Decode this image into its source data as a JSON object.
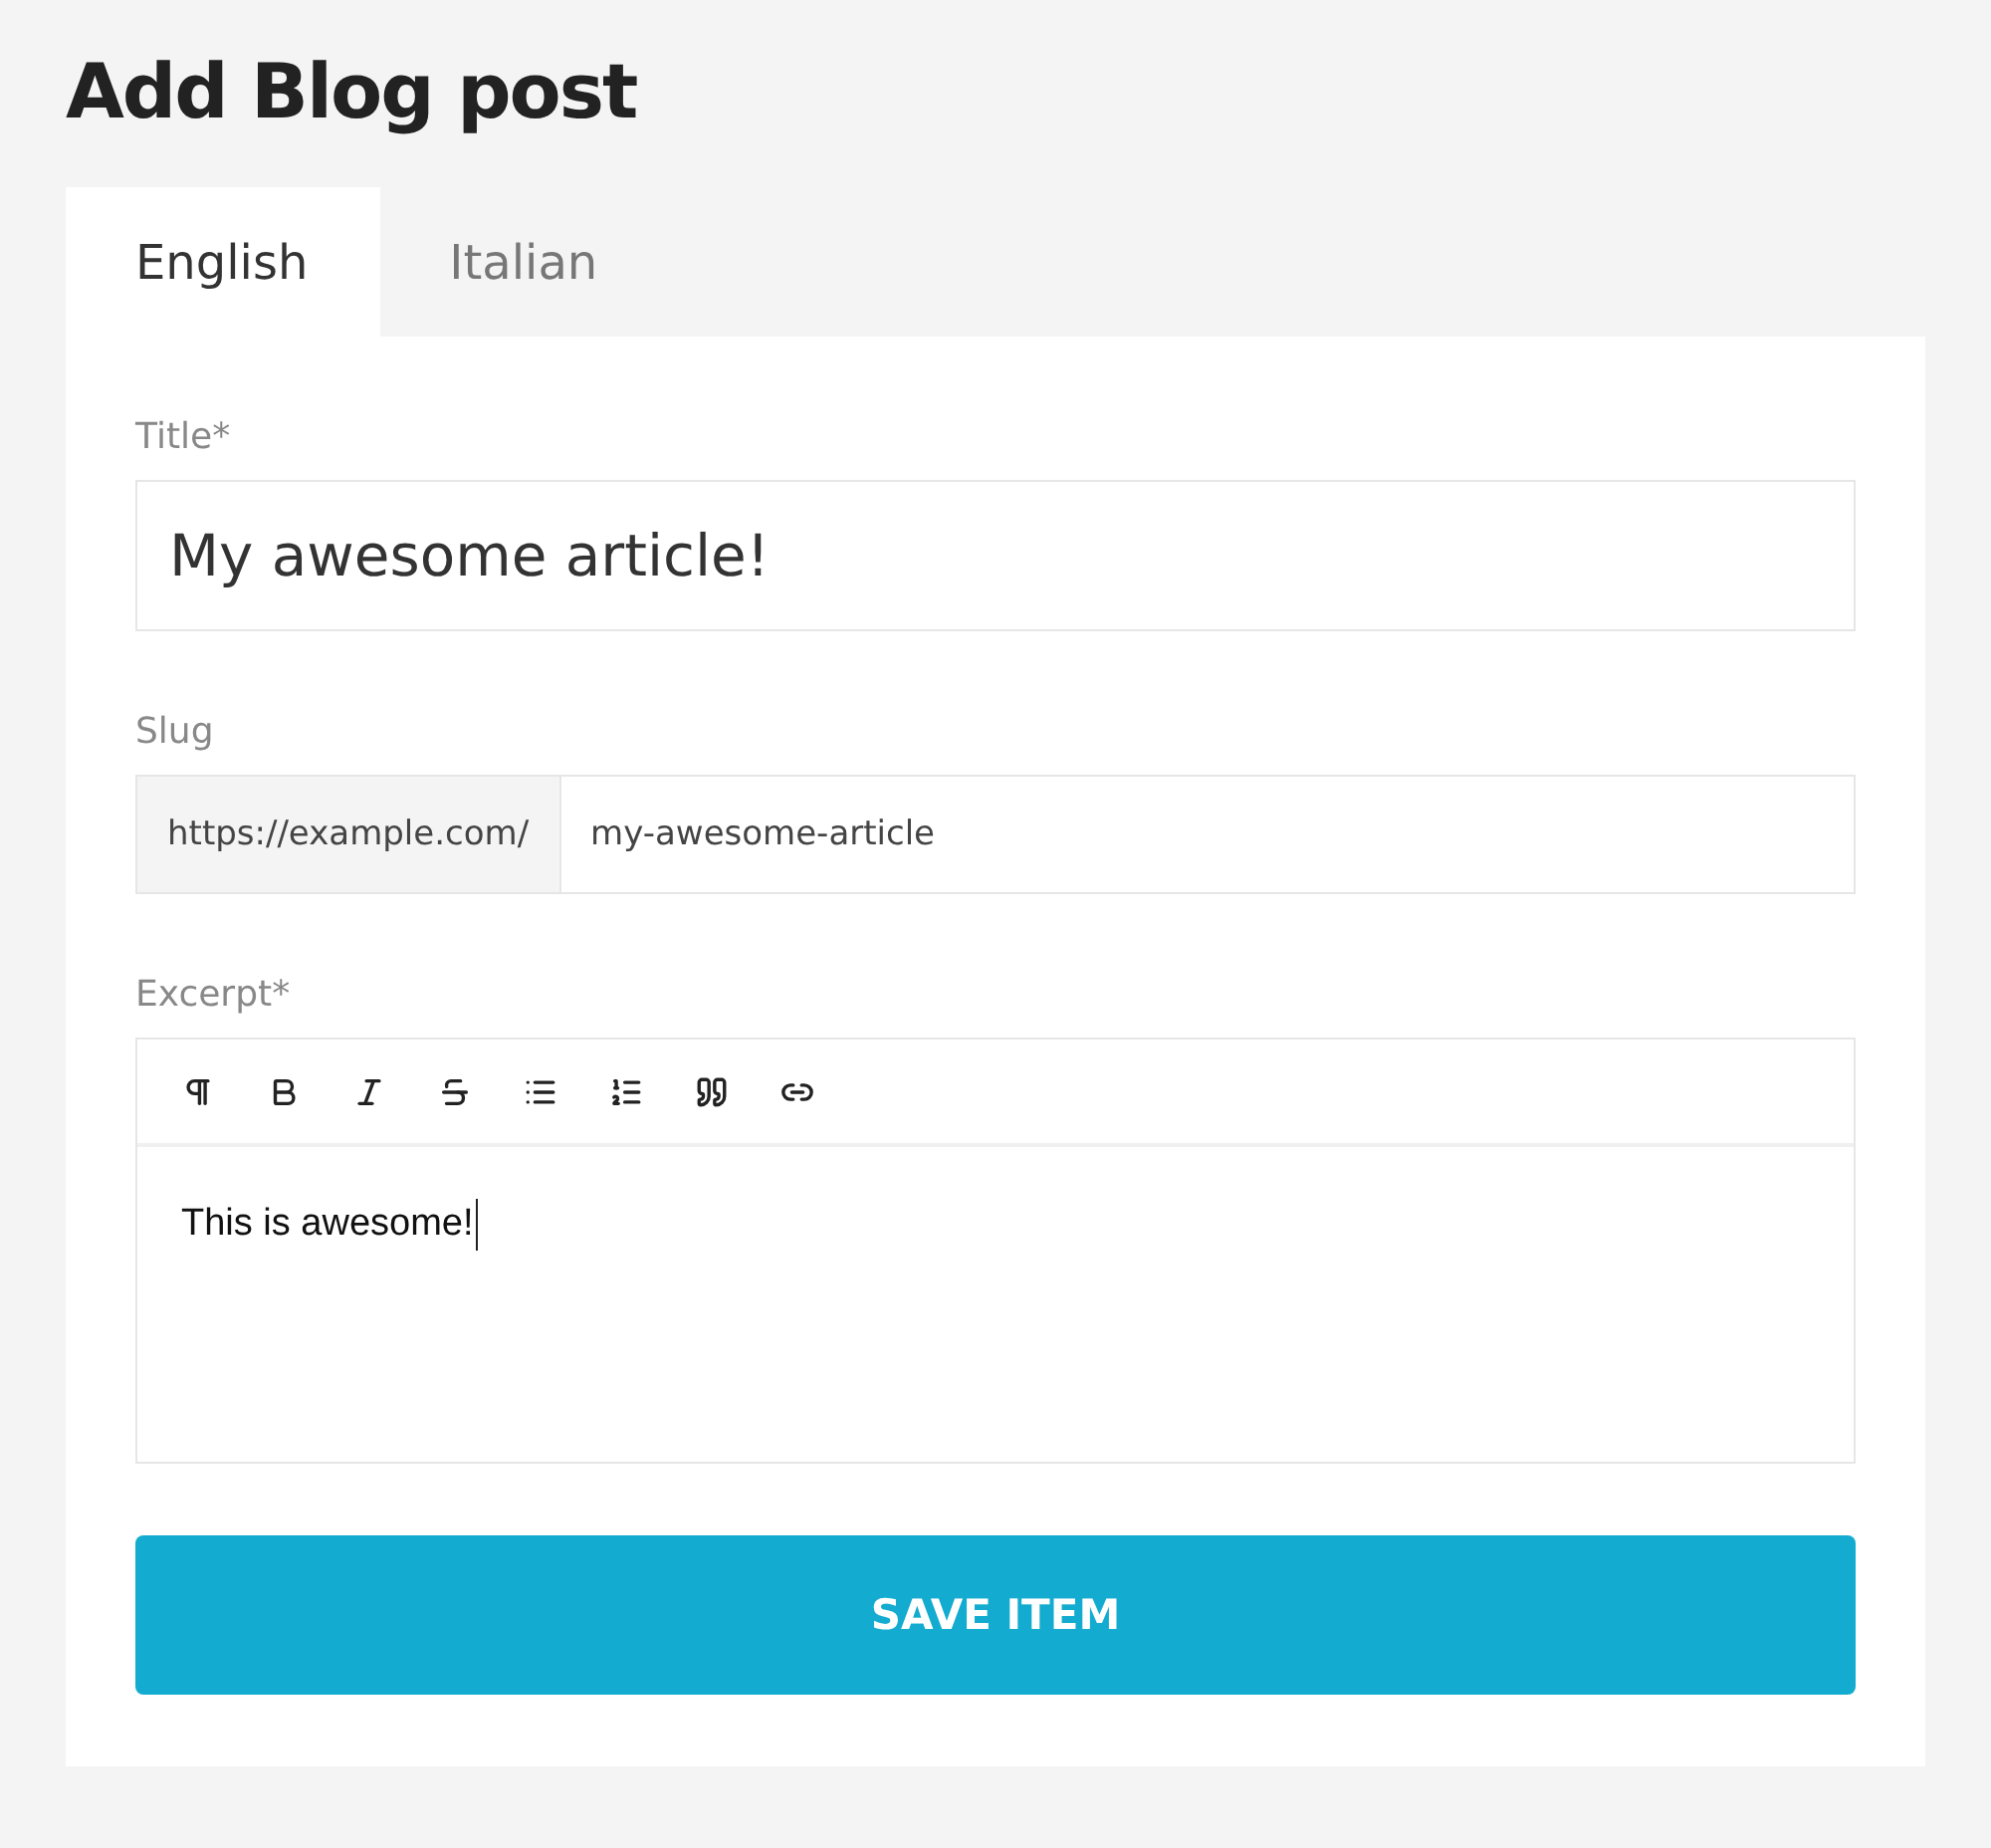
{
  "page_title": "Add Blog post",
  "tabs": [
    {
      "label": "English",
      "selected": true
    },
    {
      "label": "Italian",
      "selected": false
    }
  ],
  "form": {
    "title": {
      "label": "Title*",
      "value": "My awesome article!"
    },
    "slug": {
      "label": "Slug",
      "prefix": "https://example.com/",
      "value": "my-awesome-article"
    },
    "excerpt": {
      "label": "Excerpt*",
      "toolbar": [
        {
          "kind": "paragraph"
        },
        {
          "kind": "bold"
        },
        {
          "kind": "italic"
        },
        {
          "kind": "strike"
        },
        {
          "kind": "bullets"
        },
        {
          "kind": "numbers"
        },
        {
          "kind": "quote"
        },
        {
          "kind": "link"
        }
      ],
      "value": "This is awesome!"
    },
    "submit": "SAVE ITEM"
  }
}
